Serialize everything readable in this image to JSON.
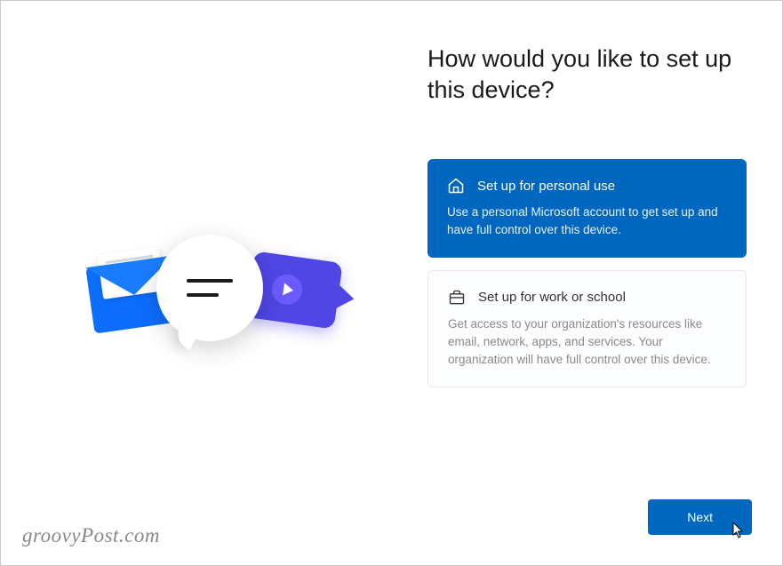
{
  "heading": "How would you like to set up this device?",
  "options": {
    "personal": {
      "title": "Set up for personal use",
      "description": "Use a personal Microsoft account to get set up and have full control over this device.",
      "selected": true
    },
    "work": {
      "title": "Set up for work or school",
      "description": "Get access to your organization's resources like email, network, apps, and services. Your organization will have full control over this device.",
      "selected": false
    }
  },
  "buttons": {
    "next": "Next"
  },
  "watermark": "groovyPost.com"
}
